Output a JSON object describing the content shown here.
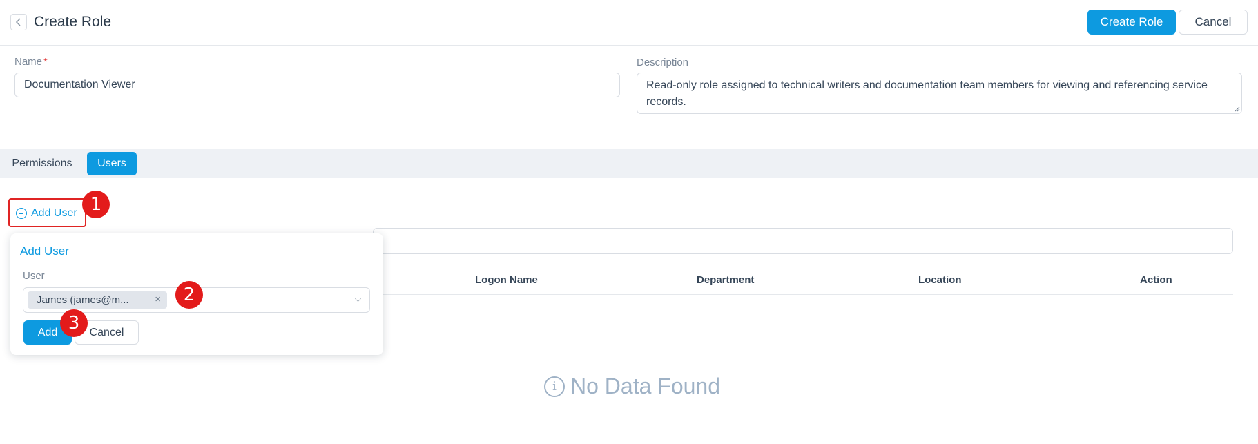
{
  "header": {
    "title": "Create Role",
    "primary_button": "Create Role",
    "cancel_button": "Cancel"
  },
  "form": {
    "name_label": "Name",
    "name_required_mark": "*",
    "name_value": "Documentation Viewer",
    "description_label": "Description",
    "description_value": "Read-only role assigned to technical writers and documentation team members for viewing and referencing service records."
  },
  "tabs": [
    {
      "label": "Permissions",
      "active": false
    },
    {
      "label": "Users",
      "active": true
    }
  ],
  "add_user_link": "Add User",
  "table": {
    "columns": [
      "Logon Name",
      "Department",
      "Location",
      "Action"
    ],
    "empty_text": "No Data Found"
  },
  "popover": {
    "title": "Add User",
    "user_label": "User",
    "selected_tag": "James (james@m...",
    "tag_remove": "×",
    "add_button": "Add",
    "cancel_button": "Cancel"
  },
  "annotations": [
    "1",
    "2",
    "3"
  ],
  "colors": {
    "accent": "#0d9ae0",
    "annotation": "#e31b1b",
    "tab_bar_bg": "#eef1f5"
  },
  "icons": [
    "chevron-left-icon",
    "plus-circle-icon",
    "chevron-down-icon",
    "info-circle-icon",
    "close-icon"
  ]
}
